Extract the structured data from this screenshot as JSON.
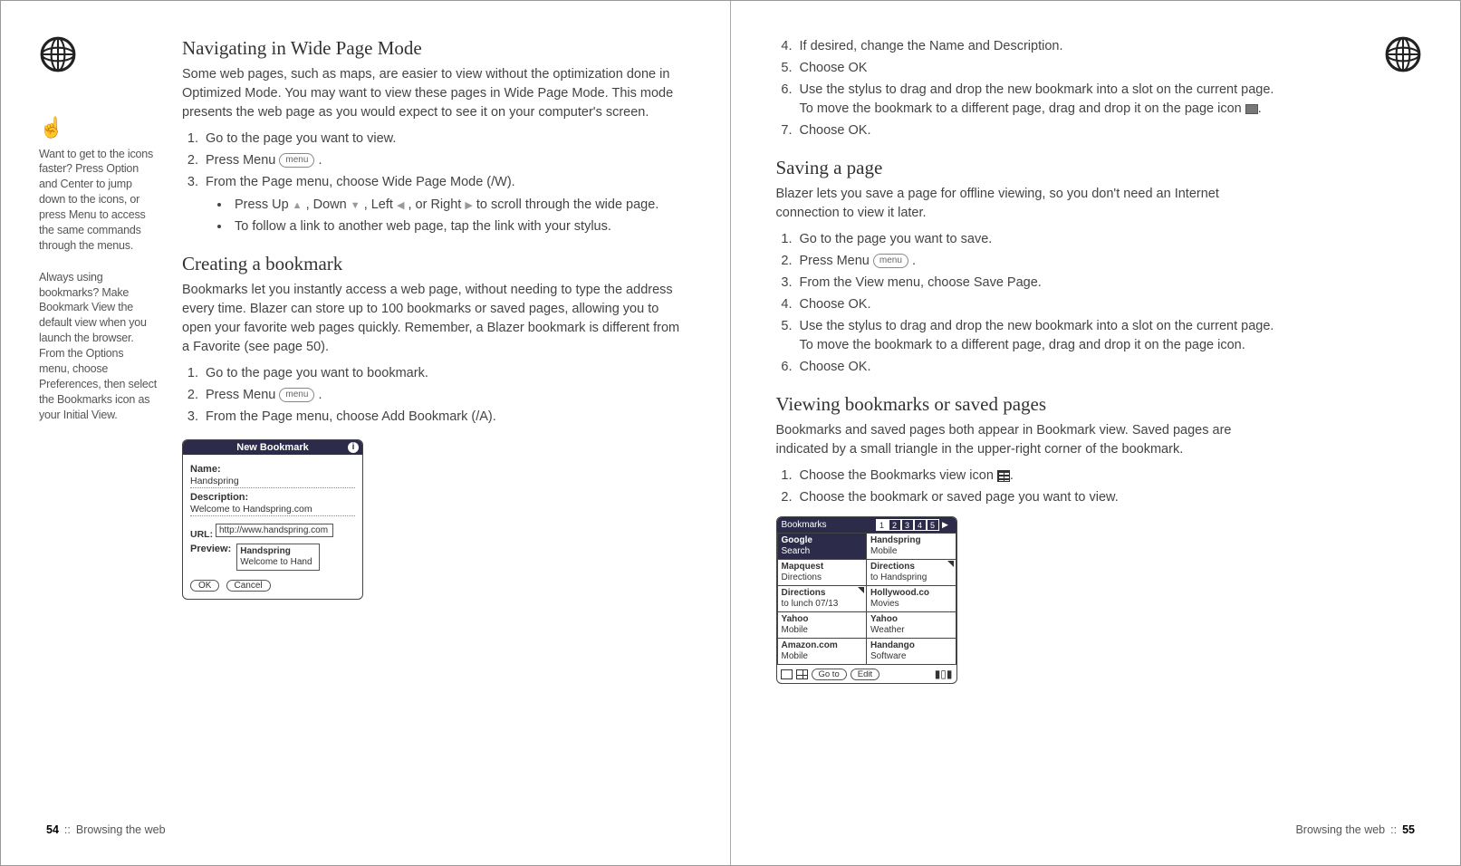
{
  "left": {
    "sidebar": {
      "tip1": "Want to get to the icons faster? Press Option and Center to jump down to the icons, or press Menu to access the same commands through the menus.",
      "tip2": "Always using bookmarks? Make Bookmark View the default view when you launch the browser. From the Options menu, choose Preferences, then select the Bookmarks icon as your Initial View."
    },
    "h1": "Navigating in Wide Page Mode",
    "p1": "Some web pages, such as maps, are easier to view without the optimization done in Optimized Mode. You may want to view these pages in Wide Page Mode. This mode presents the web page as you would expect to see it on your computer's screen.",
    "nav": {
      "s1": "Go to the page you want to view.",
      "s2a": "Press Menu ",
      "s2b": " .",
      "s3": "From the Page menu, choose Wide Page Mode (/W).",
      "b1a": "Press Up ",
      "b1b": " , Down ",
      "b1c": " , Left ",
      "b1d": " , or Right ",
      "b1e": "  to scroll through the wide page.",
      "b2": "To follow a link to another web page, tap the link with your stylus."
    },
    "h2": "Creating a bookmark",
    "p2": "Bookmarks let you instantly access a web page, without needing to type the address every time. Blazer can store up to 100 bookmarks or saved pages, allowing you to open your favorite web pages quickly. Remember, a Blazer bookmark is different from a Favorite (see page 50).",
    "cb": {
      "s1": "Go to the page you want to bookmark.",
      "s2a": "Press Menu ",
      "s2b": " .",
      "s3": "From the Page menu, choose Add Bookmark (/A)."
    },
    "dialog": {
      "title": "New Bookmark",
      "name_lbl": "Name:",
      "name_val": "Handspring",
      "desc_lbl": "Description:",
      "desc_val": "Welcome to Handspring.com",
      "url_lbl": "URL:",
      "url_val": "http://www.handspring.com",
      "prev_lbl": "Preview:",
      "prev_name": "Handspring",
      "prev_desc": "Welcome to Hand",
      "ok": "OK",
      "cancel": "Cancel"
    },
    "footer_num": "54",
    "footer_txt": "Browsing the web"
  },
  "right": {
    "top": {
      "s4": "If desired, change the Name and Description.",
      "s5": "Choose OK",
      "s6a": "Use the stylus to drag and drop the new bookmark into a slot on the current page. To move the bookmark to a different page, drag and drop it on the page icon ",
      "s6b": ".",
      "s7": "Choose OK."
    },
    "h1": "Saving a page",
    "p1": "Blazer lets you save a page for offline viewing, so you don't need an Internet connection to view it later.",
    "sp": {
      "s1": "Go to the page you want to save.",
      "s2a": "Press Menu ",
      "s2b": " .",
      "s3": "From the View menu, choose Save Page.",
      "s4": "Choose OK.",
      "s5": "Use the stylus to drag and drop the new bookmark into a slot on the current page. To move the bookmark to a different page, drag and drop it on the page icon.",
      "s6": "Choose OK."
    },
    "h2": "Viewing bookmarks or saved pages",
    "p2": "Bookmarks and saved pages both appear in Bookmark view. Saved pages are indicated by a small triangle in the upper-right corner of the bookmark.",
    "vb": {
      "s1a": "Choose the Bookmarks view icon ",
      "s1b": ".",
      "s2": "Choose the bookmark or saved page you want to view."
    },
    "bm": {
      "title": "Bookmarks",
      "tabs": [
        "1",
        "2",
        "3",
        "4",
        "5"
      ],
      "rows": [
        {
          "a_t": "Google",
          "a_s": "Search",
          "b_t": "Handspring",
          "b_s": "Mobile",
          "a_sel": true
        },
        {
          "a_t": "Mapquest",
          "a_s": "Directions",
          "b_t": "Directions",
          "b_s": "to Handspring",
          "b_tri": true
        },
        {
          "a_t": "Directions",
          "a_s": "to lunch 07/13",
          "b_t": "Hollywood.co",
          "b_s": "Movies",
          "a_tri": true
        },
        {
          "a_t": "Yahoo",
          "a_s": "Mobile",
          "b_t": "Yahoo",
          "b_s": "Weather"
        },
        {
          "a_t": "Amazon.com",
          "a_s": "Mobile",
          "b_t": "Handango",
          "b_s": "Software"
        }
      ],
      "goto": "Go to",
      "edit": "Edit"
    },
    "footer_txt": "Browsing the web",
    "footer_num": "55"
  },
  "menu_label": "menu"
}
